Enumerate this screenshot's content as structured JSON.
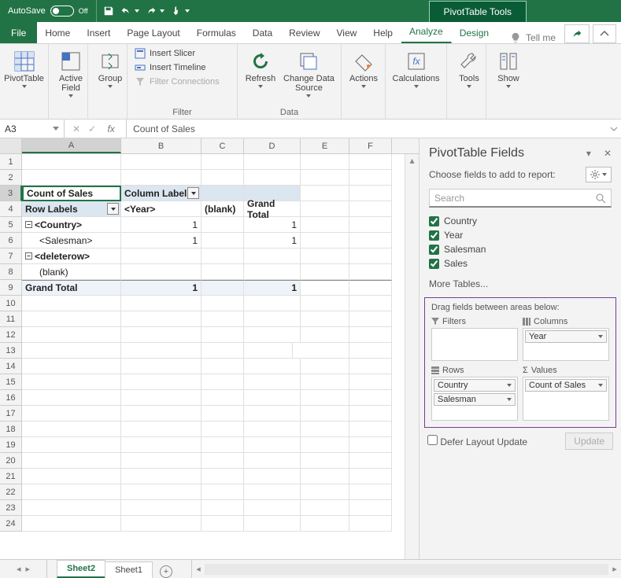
{
  "titlebar": {
    "autosave_label": "AutoSave",
    "autosave_state": "Off",
    "context_tool": "PivotTable Tools"
  },
  "tabs": {
    "file": "File",
    "list": [
      "Home",
      "Insert",
      "Page Layout",
      "Formulas",
      "Data",
      "Review",
      "View",
      "Help"
    ],
    "context": [
      "Analyze",
      "Design"
    ],
    "active": "Analyze",
    "tell_me": "Tell me"
  },
  "ribbon": {
    "g1": {
      "pivottable": "PivotTable"
    },
    "g2": {
      "active_field": "Active\nField"
    },
    "g3": {
      "group": "Group"
    },
    "filter": {
      "slicer": "Insert Slicer",
      "timeline": "Insert Timeline",
      "connections": "Filter Connections",
      "label": "Filter"
    },
    "data": {
      "refresh": "Refresh",
      "change": "Change Data\nSource",
      "label": "Data"
    },
    "actions": {
      "label": "Actions"
    },
    "calc": {
      "label": "Calculations"
    },
    "tools": {
      "label": "Tools"
    },
    "show": {
      "label": "Show"
    }
  },
  "fx": {
    "cellref": "A3",
    "formula": "Count of Sales"
  },
  "columns": [
    "A",
    "B",
    "C",
    "D",
    "E",
    "F"
  ],
  "grid": {
    "r3": {
      "A": "Count of Sales",
      "B": "Column Labels"
    },
    "r4": {
      "A": "Row Labels",
      "B": "<Year>",
      "C": "(blank)",
      "D": "Grand Total"
    },
    "r5": {
      "A": "<Country>",
      "B": "1",
      "D": "1"
    },
    "r6": {
      "A": "<Salesman>",
      "B": "1",
      "D": "1"
    },
    "r7": {
      "A": "<deleterow>"
    },
    "r8": {
      "A": "(blank)"
    },
    "r9": {
      "A": "Grand Total",
      "B": "1",
      "D": "1"
    }
  },
  "pane": {
    "title": "PivotTable Fields",
    "choose": "Choose fields to add to report:",
    "search_ph": "Search",
    "fields": [
      "Country",
      "Year",
      "Salesman",
      "Sales"
    ],
    "more": "More Tables...",
    "drag_hint": "Drag fields between areas below:",
    "area_filters": "Filters",
    "area_columns": "Columns",
    "area_rows": "Rows",
    "area_values": "Values",
    "col_items": [
      "Year"
    ],
    "row_items": [
      "Country",
      "Salesman"
    ],
    "val_items": [
      "Count of Sales"
    ],
    "defer": "Defer Layout Update",
    "update": "Update"
  },
  "sheets": {
    "list": [
      "Sheet2",
      "Sheet1"
    ],
    "active": "Sheet2"
  },
  "chart_data": {
    "type": "table",
    "title": "Count of Sales",
    "row_field": [
      "Country",
      "Salesman"
    ],
    "column_field": "Year",
    "rows": [
      "<Country>",
      "<Salesman>",
      "<deleterow>",
      "(blank)",
      "Grand Total"
    ],
    "columns": [
      "<Year>",
      "(blank)",
      "Grand Total"
    ],
    "values": [
      [
        1,
        null,
        1
      ],
      [
        1,
        null,
        1
      ],
      [
        null,
        null,
        null
      ],
      [
        null,
        null,
        null
      ],
      [
        1,
        null,
        1
      ]
    ]
  }
}
